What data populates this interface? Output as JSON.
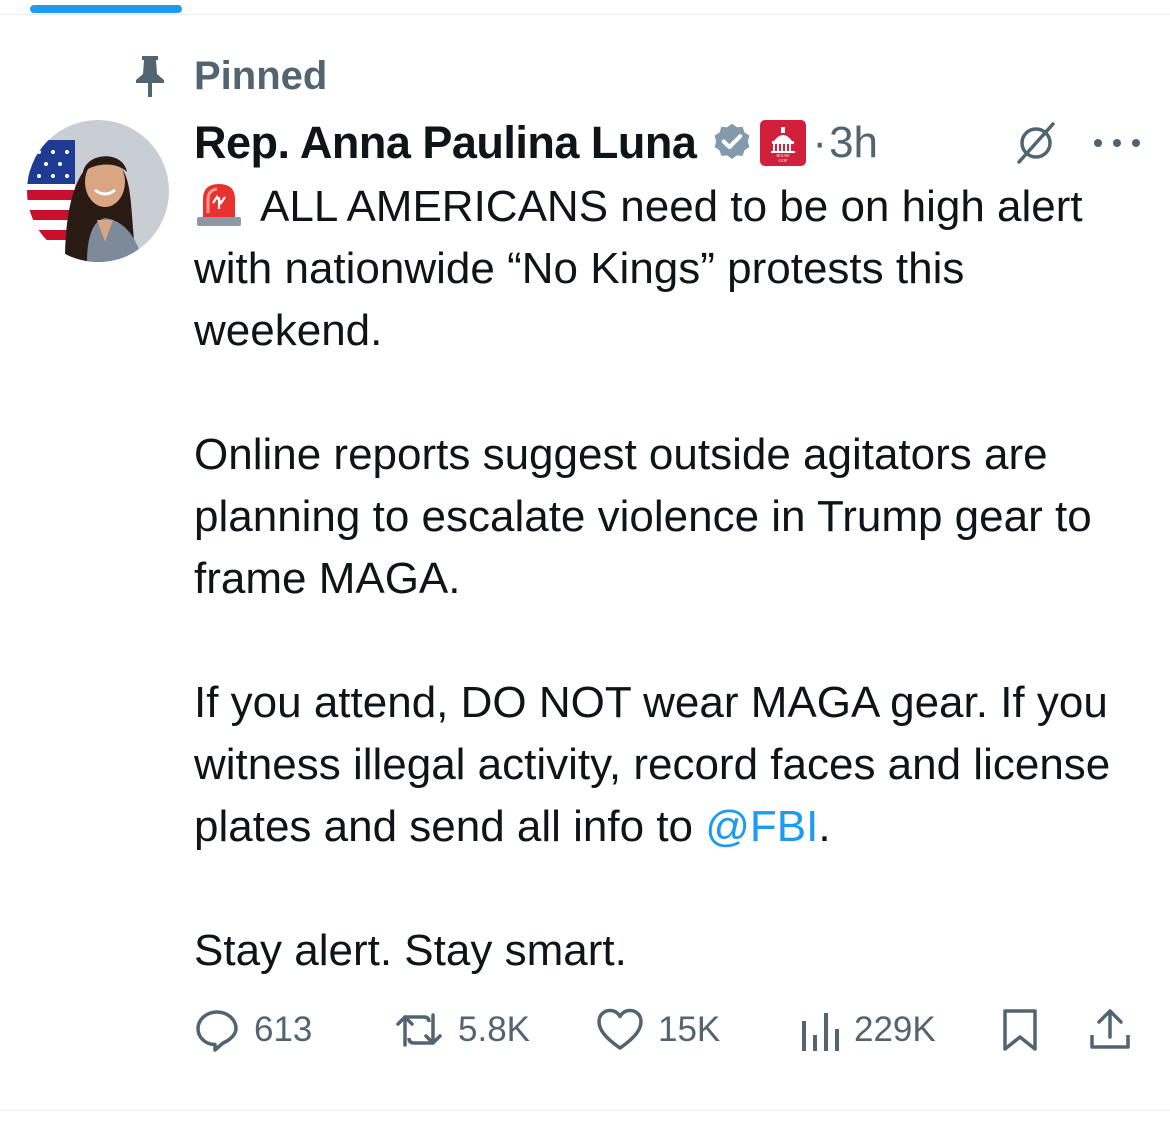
{
  "pinned": {
    "label": "Pinned",
    "icon": "pin-icon"
  },
  "author": {
    "name": "Rep. Anna Paulina Luna",
    "verified_icon": "verified-badge-icon",
    "affiliation_badge": {
      "text_line1": "HOUSE",
      "text_line2": "GOP",
      "color": "#d21f3c"
    },
    "time_separator": "·",
    "timestamp": "3h"
  },
  "tweet": {
    "line1_emoji": "siren-icon",
    "line1": "ALL AMERICANS need to be on high alert",
    "line2": "with nationwide “No Kings” protests this",
    "line3": "weekend.",
    "para2": "Online reports suggest outside agitators are planning to escalate violence in Trump gear to frame MAGA.",
    "para3_text": "If you attend, DO NOT wear MAGA gear. If you witness illegal activity, record faces and license plates and send all info to ",
    "para3_mention": "@FBI",
    "para3_end": ".",
    "para4": "Stay alert. Stay smart."
  },
  "actions": {
    "replies": "613",
    "reposts": "5.8K",
    "likes": "15K",
    "views": "229K"
  },
  "colors": {
    "accent": "#1d9bf0",
    "secondary_text": "#536471",
    "text": "#0f1419"
  }
}
